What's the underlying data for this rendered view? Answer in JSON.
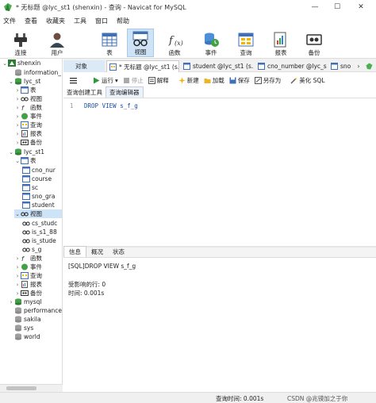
{
  "window": {
    "title": "* 无标题 @lyc_st1 (shenxin) - 查询 - Navicat for MySQL",
    "controls": [
      "—",
      "☐",
      "✕"
    ]
  },
  "menu": [
    "文件",
    "查看",
    "收藏夹",
    "工具",
    "窗口",
    "帮助"
  ],
  "toolbar": {
    "connect": "连接",
    "user": "用户",
    "table": "表",
    "view": "视图",
    "function": "函数",
    "event": "事件",
    "query": "查询",
    "report": "报表",
    "backup": "备份"
  },
  "tree": {
    "conn1": "shenxin",
    "information": "information_",
    "lyc_st": "lyc_st",
    "table": "表",
    "view": "视图",
    "function": "函数",
    "event": "事件",
    "query": "查询",
    "report": "报表",
    "backup": "备份",
    "lyc_st1": "lyc_st1",
    "t_cno": "cno_nur",
    "t_course": "course",
    "t_sc": "sc",
    "t_sno": "sno_gra",
    "t_student": "student",
    "v_cs": "cs_studc",
    "v_is1": "is_s1_88",
    "v_is": "is_stude",
    "v_sg": "s_g",
    "mysql": "mysql",
    "performance": "performance",
    "sakila": "sakila",
    "sys": "sys",
    "world": "world"
  },
  "tabs": {
    "objects": "对象",
    "query": "* 无标题 @lyc_st1 (s...",
    "student": "student @lyc_st1 (s...",
    "cno": "cno_number @lyc_s...",
    "sno": "sno"
  },
  "qtoolbar": {
    "run": "运行",
    "stop": "停止",
    "explain": "解释",
    "new": "新建",
    "load": "加载",
    "save": "保存",
    "saveas": "另存为",
    "beautify": "美化 SQL"
  },
  "subtabs": [
    "查询创建工具",
    "查询编辑器"
  ],
  "editor": {
    "line": "1",
    "code": "DROP VIEW s_f_g"
  },
  "result_tabs": [
    "信息",
    "概况",
    "状态"
  ],
  "output": {
    "sql": "[SQL]DROP VIEW s_f_g",
    "affected": "受影响的行: 0",
    "time": "时间: 0.001s"
  },
  "status": {
    "query_time": "查询时间: 0.001s",
    "watermark": "CSDN @兆镆加之于你"
  },
  "colors": {
    "accent": "#2e7d32",
    "selected": "#cde3f8",
    "keyword": "#1a4ea0"
  }
}
